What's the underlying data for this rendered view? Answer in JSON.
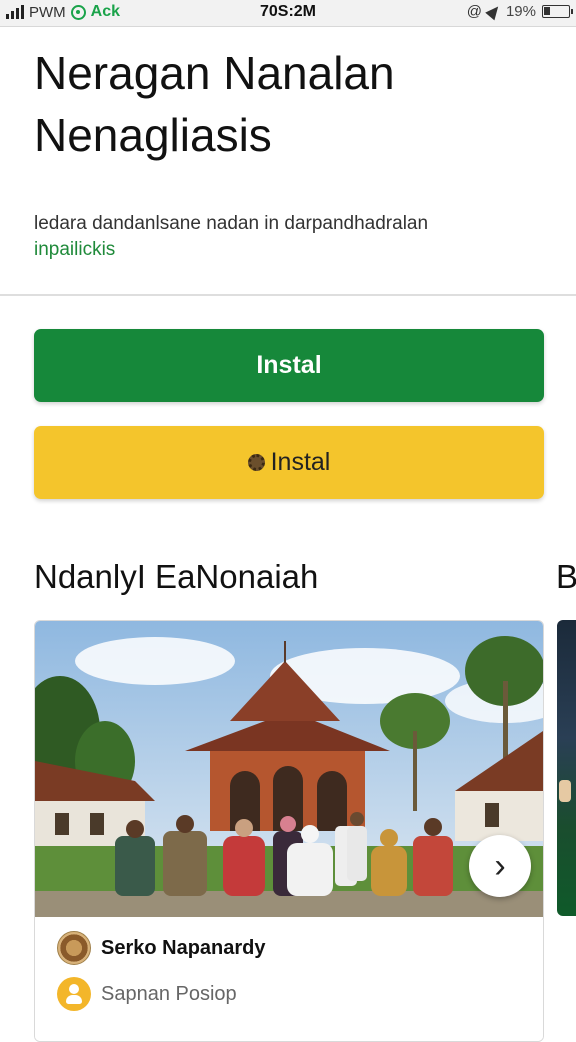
{
  "status_bar": {
    "carrier": "PWM",
    "app_name": "Ack",
    "time": "70S:2M",
    "battery": "19%"
  },
  "header": {
    "title_line1": "Neragan Nanalan",
    "title_line2": "Nenagliasis",
    "subtitle": "ledara dandanlsane nadan in darpandhadralan",
    "subtitle_link": "inpailickis"
  },
  "buttons": {
    "primary_label": "Instal",
    "secondary_label": "Instal"
  },
  "section": {
    "title": "NdanlyI EaNonaiah",
    "next_title_peek": "B"
  },
  "card": {
    "author": "Serko Napanardy",
    "subtitle": "Sapnan Posiop",
    "next_icon": "chevron-right-icon"
  },
  "colors": {
    "primary_green": "#16883a",
    "secondary_yellow": "#f4c52c",
    "link_green": "#1f8a3a"
  }
}
